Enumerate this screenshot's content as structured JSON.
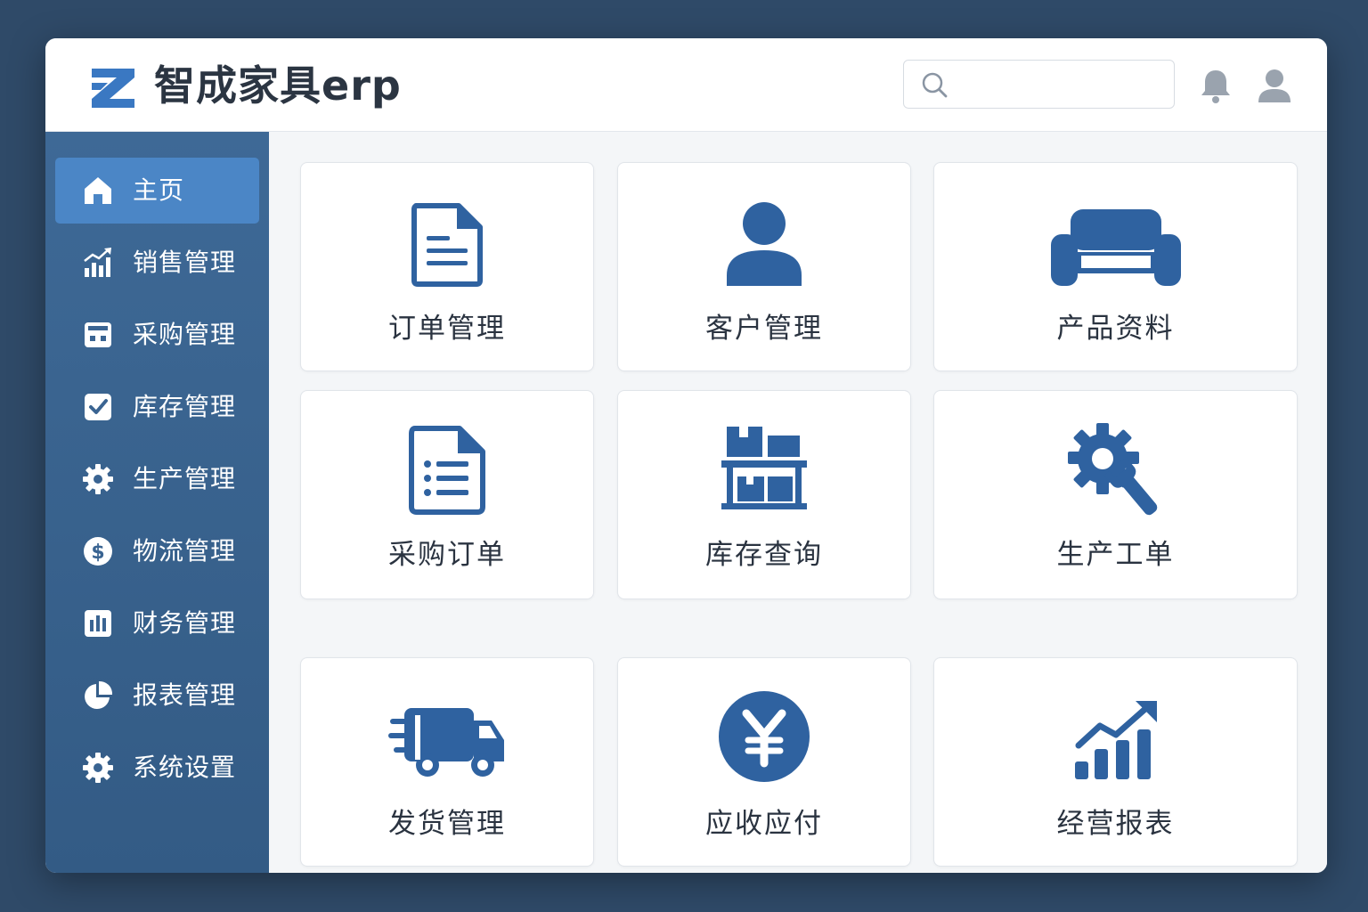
{
  "header": {
    "title": "智成家具erp",
    "search_placeholder": "",
    "icons": [
      "search-icon",
      "bell-icon",
      "user-icon"
    ]
  },
  "sidebar": {
    "items": [
      {
        "label": "主页",
        "icon": "home-icon",
        "active": true
      },
      {
        "label": "销售管理",
        "icon": "sales-chart-icon"
      },
      {
        "label": "采购管理",
        "icon": "purchase-icon"
      },
      {
        "label": "库存管理",
        "icon": "checkbox-icon"
      },
      {
        "label": "生产管理",
        "icon": "gear-icon"
      },
      {
        "label": "物流管理",
        "icon": "dollar-icon"
      },
      {
        "label": "财务管理",
        "icon": "bar-chart-icon"
      },
      {
        "label": "报表管理",
        "icon": "pie-chart-icon"
      },
      {
        "label": "系统设置",
        "icon": "settings-icon"
      }
    ]
  },
  "cards": [
    {
      "label": "订单管理",
      "icon": "document-icon"
    },
    {
      "label": "客户管理",
      "icon": "person-icon"
    },
    {
      "label": "产品资料",
      "icon": "sofa-icon"
    },
    {
      "label": "采购订单",
      "icon": "list-document-icon"
    },
    {
      "label": "库存查询",
      "icon": "warehouse-icon"
    },
    {
      "label": "生产工单",
      "icon": "gear-wrench-icon"
    },
    {
      "label": "发货管理",
      "icon": "truck-icon"
    },
    {
      "label": "应收应付",
      "icon": "yen-icon"
    },
    {
      "label": "经营报表",
      "icon": "growth-chart-icon"
    }
  ],
  "colors": {
    "accent": "#2f62a0",
    "sidebar": "#3a6492",
    "active": "#4b86c6",
    "background": "#2f4a68"
  }
}
